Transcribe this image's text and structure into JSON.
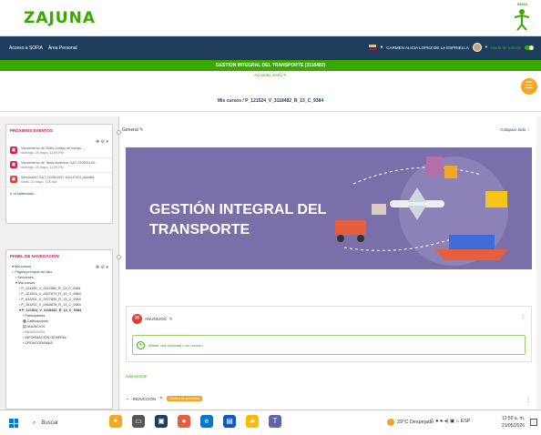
{
  "header": {
    "logo_text": "ZAJUNA",
    "sena_label": "SENA"
  },
  "topnav": {
    "links": [
      "Acceso a SOFIA",
      "Área Personal"
    ],
    "user_name": "CARMEN ALICIA LOPEZ DE LA ESPRIELLA",
    "mode_label": "Modo de edición"
  },
  "course": {
    "title": "GESTION INTEGRAL DEL TRANSPORTE (3118482)",
    "action_menu": "Acciones menú",
    "breadcrumb": "Mis cursos / P_121524_V_3118482_R_13_C_9384"
  },
  "sidebar": {
    "events_title": "PRÓXIMOS EVENTOS",
    "events": [
      {
        "title": "Vencimiento de Video código de barras ...",
        "date": "domingo, 26 mayo, 11:59 PM"
      },
      {
        "title": "Vencimiento de Tabla dinámica GA7-220501100...",
        "date": "domingo, 26 mayo, 11:59 PM"
      },
      {
        "title": "Simulación GA7-220501097-AA4-EV01 plantilla",
        "date": "lunes, 20 mayo, 1:00 AM"
      }
    ],
    "calendar_link": "Ir al calendario...",
    "nav_title": "PANEL DE NAVEGACIÓN",
    "nav_items": [
      {
        "label": "Mis cursos",
        "level": 0
      },
      {
        "label": "Página principal del sitio",
        "level": 0,
        "home": true
      },
      {
        "label": "Secciones",
        "level": 1
      },
      {
        "label": "Mis cursos",
        "level": 1
      },
      {
        "label": "P_124100_V_3112580_R_13_C_9384",
        "level": 1
      },
      {
        "label": "P_121524_V_2847873_R_13_C_9384",
        "level": 1
      },
      {
        "label": "P_632201_V_2977809_R_13_C_9384",
        "level": 1
      },
      {
        "label": "P_151292_V_2464878_R_13_C_9384",
        "level": 1
      },
      {
        "label": "P_121524_V_3118482_R_13_C_9384",
        "level": 1,
        "bold": true
      },
      {
        "label": "Participantes",
        "level": 2
      },
      {
        "label": "Calificaciones",
        "level": 2
      },
      {
        "label": "ANUNCIOS",
        "level": 2
      },
      {
        "label": "INDUCCIÓN",
        "level": 2,
        "dim": true
      },
      {
        "label": "INFORMACIÓN GENERAL",
        "level": 2
      },
      {
        "label": "CRONOGRAMAS",
        "level": 2
      }
    ]
  },
  "main": {
    "section_title": "General",
    "collapse_all": "Colapsar todo",
    "banner_line1": "GESTIÓN INTEGRAL DEL",
    "banner_line2": "TRANSPORTE",
    "announcements_label": "ANUNCIOS",
    "add_activity": "Añadir una actividad o un recurso",
    "add_section": "Add section",
    "induction_label": "INDUCCIÓN",
    "induction_tag": "Oculto a los aprendices"
  },
  "taskbar": {
    "search_placeholder": "Buscar",
    "weather": "29°C Despejado",
    "lang": "ESP",
    "time": "12:50 a. m.",
    "date": "21/05/2026"
  },
  "colors": {
    "accent_green": "#39a900",
    "nav_blue": "#1e3d5c",
    "banner_purple": "#7a6fa8",
    "events_pink": "#d81b60"
  }
}
